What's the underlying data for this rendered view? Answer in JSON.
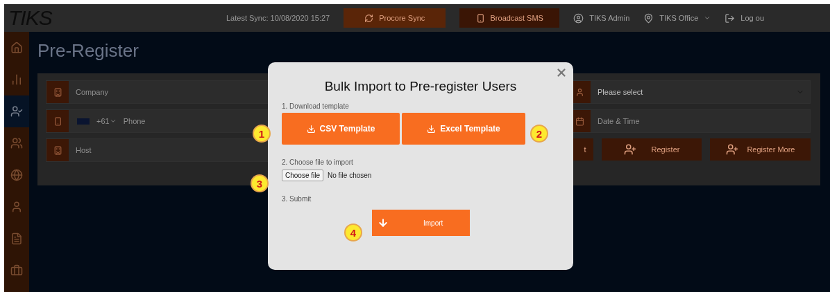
{
  "topbar": {
    "logo": "TIKS",
    "sync": "Latest Sync: 10/08/2020 15:27",
    "buttons": [
      "Procore Sync",
      "Broadcast SMS"
    ],
    "user": "TIKS Admin",
    "office": "TIKS Office",
    "logout": "Log ou"
  },
  "sidebar": {
    "items": [
      {
        "selected": false
      },
      {
        "selected": false
      },
      {
        "selected": true
      },
      {
        "selected": false
      },
      {
        "selected": false
      },
      {
        "selected": false
      },
      {
        "selected": false
      },
      {
        "selected": false
      }
    ]
  },
  "page_title": "Pre-Register",
  "form": {
    "left": [
      {
        "kind": "text",
        "placeholder": "Company"
      },
      {
        "kind": "phone",
        "code": "+61",
        "placeholder": "Phone"
      },
      {
        "kind": "text",
        "placeholder": "Host"
      }
    ],
    "right": [
      {
        "kind": "select",
        "value": "Please select"
      },
      {
        "kind": "text",
        "placeholder": "Date & Time"
      }
    ],
    "buttons": [
      "t",
      "Register",
      "Register More"
    ]
  },
  "modal": {
    "title": "Bulk Import to Pre-register Users",
    "steps": [
      "1. Download template",
      "2. Choose file to import",
      "3. Submit"
    ],
    "templates": [
      "CSV Template",
      "Excel Template"
    ],
    "file_button": "Choose file",
    "file_status": "No file chosen",
    "import": "Import",
    "callouts": [
      "1",
      "2",
      "3",
      "4"
    ]
  }
}
